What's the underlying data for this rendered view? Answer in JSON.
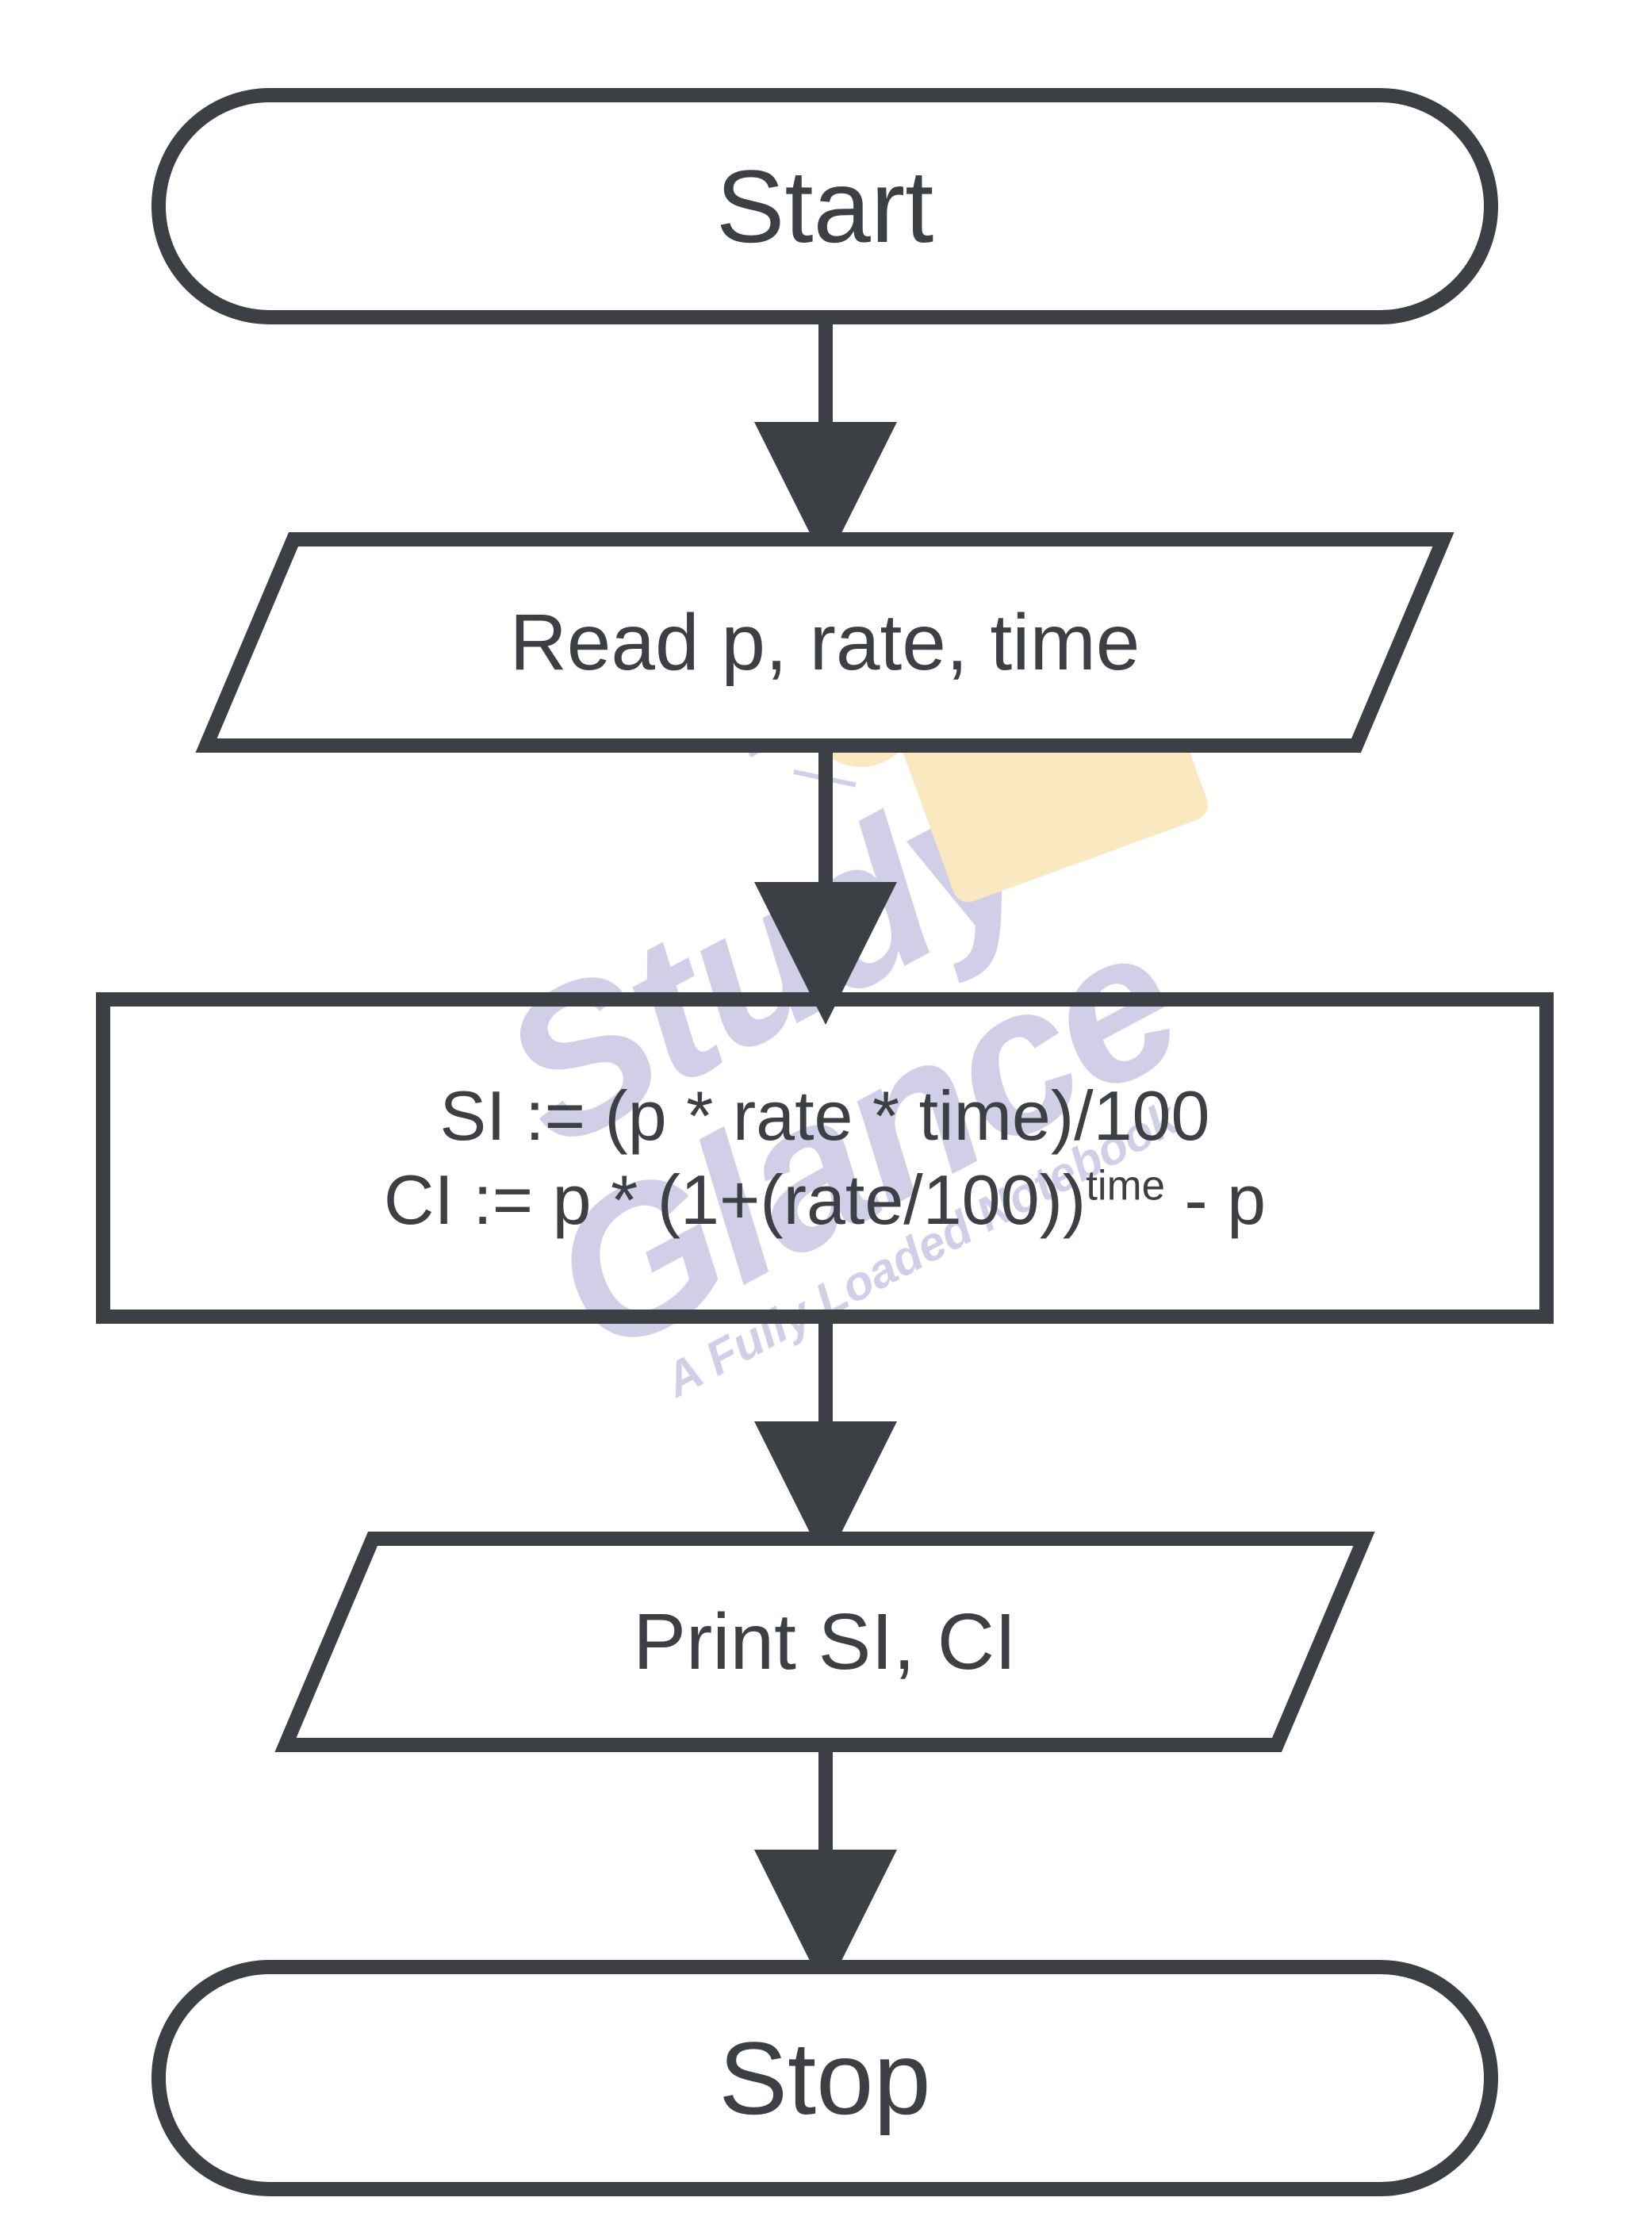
{
  "flowchart": {
    "start": "Start",
    "read": "Read p, rate, time",
    "process_line1": "SI := (p * rate * time)/100",
    "process_line2_pre": "CI := p * (1+(rate/100))",
    "process_line2_sup": "time",
    "process_line2_post": " - p",
    "print": "Print SI, CI",
    "stop": "Stop"
  },
  "watermark": {
    "main": "Study Glance",
    "sub": "A Fully Loaded Notebook"
  },
  "style": {
    "stroke": "#3c4044",
    "stroke_width": 18
  }
}
